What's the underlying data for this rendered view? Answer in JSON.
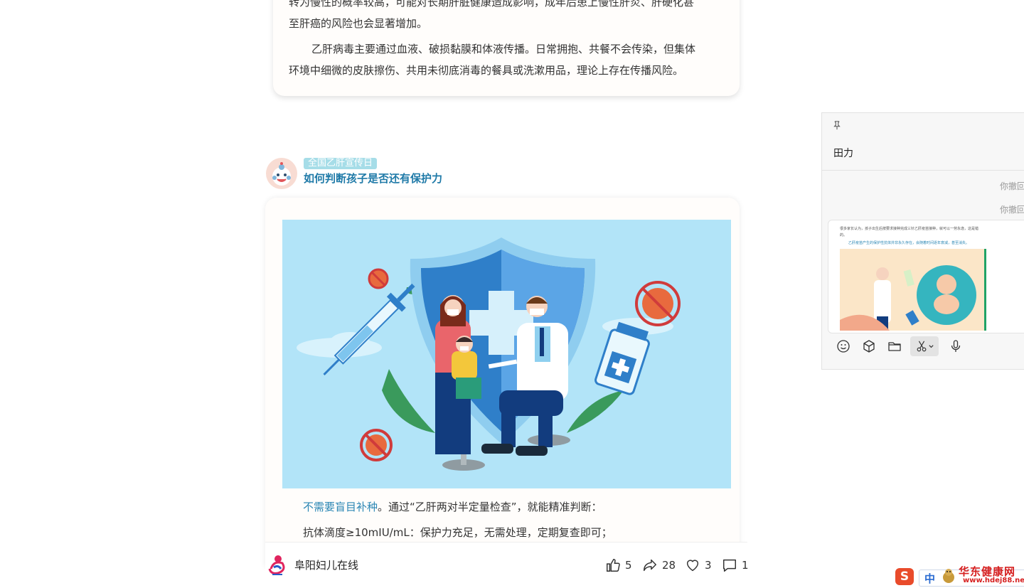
{
  "article": {
    "para1_tail_top": "转为慢性的概率较高，可能对长期肝脏健康造成影响，成年后患上慢性肝炎、肝硬化甚",
    "para1_tail_bottom": "至肝癌的风险也会显著增加。",
    "para2_line1": "乙肝病毒主要通过血液、破损黏膜和体液传播。日常拥抱、共餐不会传染，但集体",
    "para2_line2": "环境中细微的皮肤擦伤、共用未彻底消毒的餐具或洗漱用品，理论上存在传播风险。"
  },
  "post": {
    "tag": "全国乙肝宣传日",
    "title": "如何判断孩子是否还有保护力",
    "highlight": "不需要盲目补种",
    "text_after_highlight": "。通过“乙肝两对半定量检查”，就能精准判断：",
    "line2": "抗体滴度≥10mIU/mL：保护力充足，无需处理，定期复查即可；"
  },
  "footer": {
    "account_name": "阜阳妇儿在线",
    "likes": "5",
    "shares": "28",
    "favorites": "3",
    "comments": "1"
  },
  "chat": {
    "contact_name": "田力",
    "recall_1": "你撤回",
    "recall_2": "你撤回",
    "thumb_text_1": "很多家长认为，孩子出生后按要求接种完成三针乙肝疫苗接种，就可以一劳永逸，这是错的。",
    "thumb_text_2": "乙肝疫苗产生的保护性抗体并非永久存在，会随着时间逐年衰减，甚至消失。"
  },
  "ime": {
    "mode": "中",
    "watermark": "华东健康网",
    "url": "www.hdej88.net"
  },
  "icons": [
    "pin-icon",
    "emoji-icon",
    "cube-icon",
    "folder-icon",
    "scissors-icon",
    "chevron-down-icon",
    "microphone-icon",
    "like-icon",
    "share-icon",
    "heart-icon",
    "comment-icon"
  ],
  "colors": {
    "accent": "#1f7aa8",
    "tag_bg": "#a6dde8",
    "illus_bg": "#b2e4f8"
  }
}
